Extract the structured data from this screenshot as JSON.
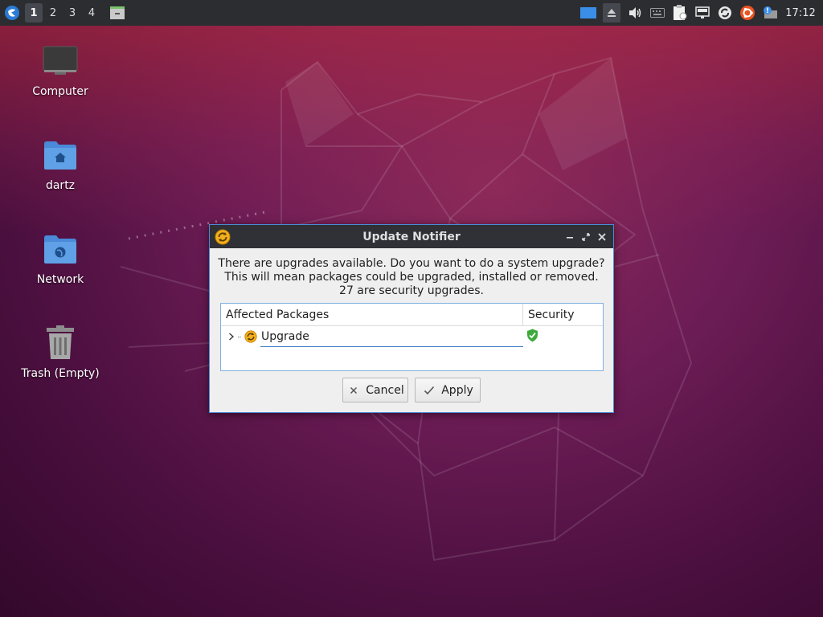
{
  "panel": {
    "workspaces": [
      "1",
      "2",
      "3",
      "4"
    ],
    "active_workspace": "1",
    "clock": "17:12",
    "tray_icons": [
      "display-icon",
      "eject-icon",
      "volume-icon",
      "keyboard-icon",
      "clipboard-icon",
      "network-icon",
      "sync-icon",
      "ubuntu-icon",
      "notification-icon"
    ]
  },
  "desktop": {
    "icons": [
      {
        "label": "Computer",
        "icon": "computer-icon"
      },
      {
        "label": "dartz",
        "icon": "home-folder-icon"
      },
      {
        "label": "Network",
        "icon": "network-folder-icon"
      },
      {
        "label": "Trash (Empty)",
        "icon": "trash-icon"
      }
    ]
  },
  "dialog": {
    "title": "Update Notifier",
    "message_lines": [
      "There are upgrades available. Do you want to do a system upgrade?",
      "This will mean packages could be upgraded, installed or removed.",
      "27 are security upgrades."
    ],
    "columns": {
      "packages": "Affected Packages",
      "security": "Security"
    },
    "rows": [
      {
        "label": "Upgrade",
        "security": "shield-check-icon"
      }
    ],
    "buttons": {
      "cancel": "Cancel",
      "apply": "Apply"
    }
  },
  "colors": {
    "panel_bg": "#2b2d31",
    "dialog_border": "#4a8cd4",
    "security_green": "#3caa3c",
    "updater_orange": "#f2b01e"
  }
}
